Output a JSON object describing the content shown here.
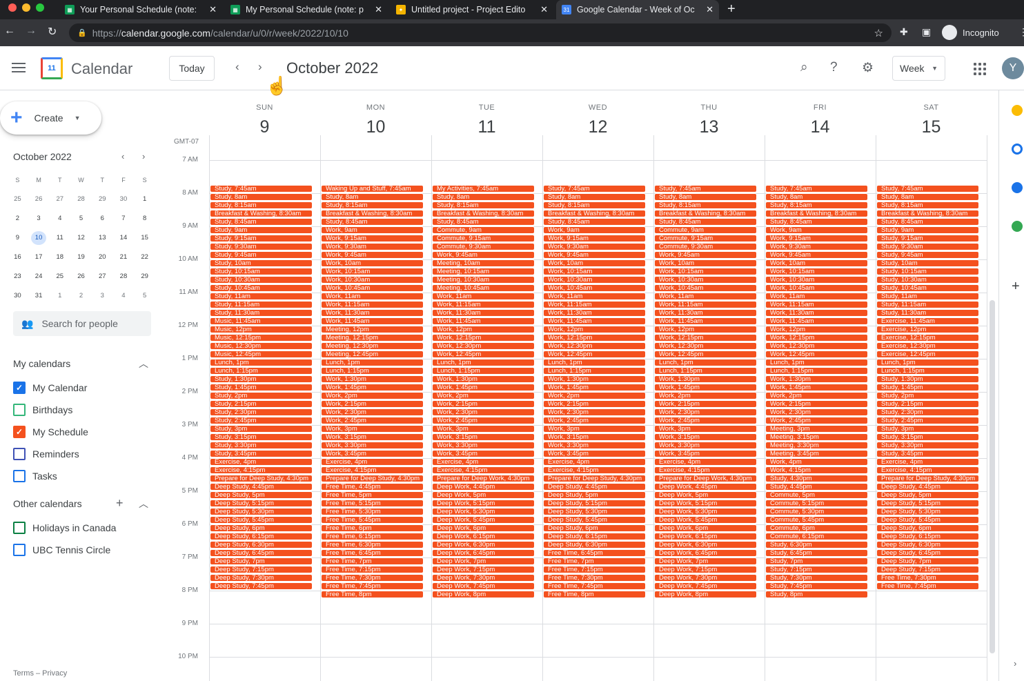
{
  "browser": {
    "tabs": [
      {
        "title": "Your Personal Schedule (note:",
        "icon": "sheets-icon",
        "color": "#0f9d58"
      },
      {
        "title": "My Personal Schedule (note: p",
        "icon": "sheets-icon",
        "color": "#0f9d58"
      },
      {
        "title": "Untitled project - Project Edito",
        "icon": "project-icon",
        "color": "#f4b400"
      },
      {
        "title": "Google Calendar - Week of Oc",
        "icon": "calendar-icon",
        "color": "#4285f4"
      }
    ],
    "url_prefix": "https://",
    "url_host": "calendar.google.com",
    "url_path": "/calendar/u/0/r/week/2022/10/10",
    "incognito_label": "Incognito"
  },
  "header": {
    "app_name": "Calendar",
    "logo_text": "11",
    "today_label": "Today",
    "title": "October 2022",
    "view_label": "Week",
    "avatar_letter": "Y"
  },
  "sidebar": {
    "create_label": "Create",
    "mini_title": "October 2022",
    "weekday_headers": [
      "S",
      "M",
      "T",
      "W",
      "T",
      "F",
      "S"
    ],
    "weeks": [
      [
        "25",
        "26",
        "27",
        "28",
        "29",
        "30",
        "1"
      ],
      [
        "2",
        "3",
        "4",
        "5",
        "6",
        "7",
        "8"
      ],
      [
        "9",
        "10",
        "11",
        "12",
        "13",
        "14",
        "15"
      ],
      [
        "16",
        "17",
        "18",
        "19",
        "20",
        "21",
        "22"
      ],
      [
        "23",
        "24",
        "25",
        "26",
        "27",
        "28",
        "29"
      ],
      [
        "30",
        "31",
        "1",
        "2",
        "3",
        "4",
        "5"
      ]
    ],
    "search_people_placeholder": "Search for people",
    "my_calendars_title": "My calendars",
    "my_calendars": [
      {
        "label": "My Calendar",
        "color": "#1a73e8",
        "checked": true
      },
      {
        "label": "Birthdays",
        "color": "#33b679",
        "checked": false
      },
      {
        "label": "My Schedule",
        "color": "#f4511e",
        "checked": true
      },
      {
        "label": "Reminders",
        "color": "#3f51b5",
        "checked": false
      },
      {
        "label": "Tasks",
        "color": "#1a73e8",
        "checked": false
      }
    ],
    "other_calendars_title": "Other calendars",
    "other_calendars": [
      {
        "label": "Holidays in Canada",
        "color": "#0b8043",
        "checked": false
      },
      {
        "label": "UBC Tennis Circle",
        "color": "#1a73e8",
        "checked": false
      }
    ],
    "footer": "Terms – Privacy"
  },
  "grid": {
    "timezone": "GMT-07",
    "days": [
      {
        "name": "SUN",
        "num": "9"
      },
      {
        "name": "MON",
        "num": "10"
      },
      {
        "name": "TUE",
        "num": "11"
      },
      {
        "name": "WED",
        "num": "12"
      },
      {
        "name": "THU",
        "num": "13"
      },
      {
        "name": "FRI",
        "num": "14"
      },
      {
        "name": "SAT",
        "num": "15"
      }
    ],
    "hours": [
      "7 AM",
      "8 AM",
      "9 AM",
      "10 AM",
      "11 AM",
      "12 PM",
      "1 PM",
      "2 PM",
      "3 PM",
      "4 PM",
      "5 PM",
      "6 PM",
      "7 PM",
      "8 PM",
      "9 PM",
      "10 PM"
    ],
    "event_color": "#f4511e",
    "events": [
      [
        "Study, 7:45am",
        "Study, 8am",
        "Study, 8:15am",
        "Breakfast & Washing, 8:30am",
        "Study, 8:45am",
        "Study, 9am",
        "Study, 9:15am",
        "Study, 9:30am",
        "Study, 9:45am",
        "Study, 10am",
        "Study, 10:15am",
        "Study, 10:30am",
        "Study, 10:45am",
        "Study, 11am",
        "Study, 11:15am",
        "Study, 11:30am",
        "Music, 11:45am",
        "Music, 12pm",
        "Music, 12:15pm",
        "Music, 12:30pm",
        "Music, 12:45pm",
        "Lunch, 1pm",
        "Lunch, 1:15pm",
        "Study, 1:30pm",
        "Study, 1:45pm",
        "Study, 2pm",
        "Study, 2:15pm",
        "Study, 2:30pm",
        "Study, 2:45pm",
        "Study, 3pm",
        "Study, 3:15pm",
        "Study, 3:30pm",
        "Study, 3:45pm",
        "Exercise, 4pm",
        "Exercise, 4:15pm",
        "Prepare for Deep Study, 4:30pm",
        "Deep Study, 4:45pm",
        "Deep Study, 5pm",
        "Deep Study, 5:15pm",
        "Deep Study, 5:30pm",
        "Deep Study, 5:45pm",
        "Deep Study, 6pm",
        "Deep Study, 6:15pm",
        "Deep Study, 6:30pm",
        "Deep Study, 6:45pm",
        "Deep Study, 7pm",
        "Deep Study, 7:15pm",
        "Deep Study, 7:30pm",
        "Deep Study, 7:45pm"
      ],
      [
        "Waking Up and Stuff, 7:45am",
        "Study, 8am",
        "Study, 8:15am",
        "Breakfast & Washing, 8:30am",
        "Study, 8:45am",
        "Work, 9am",
        "Work, 9:15am",
        "Work, 9:30am",
        "Work, 9:45am",
        "Work, 10am",
        "Work, 10:15am",
        "Work, 10:30am",
        "Work, 10:45am",
        "Work, 11am",
        "Work, 11:15am",
        "Work, 11:30am",
        "Work, 11:45am",
        "Meeting, 12pm",
        "Meeting, 12:15pm",
        "Meeting, 12:30pm",
        "Meeting, 12:45pm",
        "Lunch, 1pm",
        "Lunch, 1:15pm",
        "Work, 1:30pm",
        "Work, 1:45pm",
        "Work, 2pm",
        "Work, 2:15pm",
        "Work, 2:30pm",
        "Work, 2:45pm",
        "Work, 3pm",
        "Work, 3:15pm",
        "Work, 3:30pm",
        "Work, 3:45pm",
        "Exercise, 4pm",
        "Exercise, 4:15pm",
        "Prepare for Deep Study, 4:30pm",
        "Free Time, 4:45pm",
        "Free Time, 5pm",
        "Free Time, 5:15pm",
        "Free Time, 5:30pm",
        "Free Time, 5:45pm",
        "Free Time, 6pm",
        "Free Time, 6:15pm",
        "Free Time, 6:30pm",
        "Free Time, 6:45pm",
        "Free Time, 7pm",
        "Free Time, 7:15pm",
        "Free Time, 7:30pm",
        "Free Time, 7:45pm",
        "Free Time, 8pm"
      ],
      [
        "My Activities, 7:45am",
        "Study, 8am",
        "Study, 8:15am",
        "Breakfast & Washing, 8:30am",
        "Study, 8:45am",
        "Commute, 9am",
        "Commute, 9:15am",
        "Commute, 9:30am",
        "Work, 9:45am",
        "Meeting, 10am",
        "Meeting, 10:15am",
        "Meeting, 10:30am",
        "Meeting, 10:45am",
        "Work, 11am",
        "Work, 11:15am",
        "Work, 11:30am",
        "Work, 11:45am",
        "Work, 12pm",
        "Work, 12:15pm",
        "Work, 12:30pm",
        "Work, 12:45pm",
        "Lunch, 1pm",
        "Lunch, 1:15pm",
        "Work, 1:30pm",
        "Work, 1:45pm",
        "Work, 2pm",
        "Work, 2:15pm",
        "Work, 2:30pm",
        "Work, 2:45pm",
        "Work, 3pm",
        "Work, 3:15pm",
        "Work, 3:30pm",
        "Work, 3:45pm",
        "Exercise, 4pm",
        "Exercise, 4:15pm",
        "Prepare for Deep Work, 4:30pm",
        "Deep Work, 4:45pm",
        "Deep Work, 5pm",
        "Deep Work, 5:15pm",
        "Deep Work, 5:30pm",
        "Deep Work, 5:45pm",
        "Deep Work, 6pm",
        "Deep Work, 6:15pm",
        "Deep Work, 6:30pm",
        "Deep Work, 6:45pm",
        "Deep Work, 7pm",
        "Deep Work, 7:15pm",
        "Deep Work, 7:30pm",
        "Deep Work, 7:45pm",
        "Deep Work, 8pm"
      ],
      [
        "Study, 7:45am",
        "Study, 8am",
        "Study, 8:15am",
        "Breakfast & Washing, 8:30am",
        "Study, 8:45am",
        "Work, 9am",
        "Work, 9:15am",
        "Work, 9:30am",
        "Work, 9:45am",
        "Work, 10am",
        "Work, 10:15am",
        "Work, 10:30am",
        "Work, 10:45am",
        "Work, 11am",
        "Work, 11:15am",
        "Work, 11:30am",
        "Work, 11:45am",
        "Work, 12pm",
        "Work, 12:15pm",
        "Work, 12:30pm",
        "Work, 12:45pm",
        "Lunch, 1pm",
        "Lunch, 1:15pm",
        "Work, 1:30pm",
        "Work, 1:45pm",
        "Work, 2pm",
        "Work, 2:15pm",
        "Work, 2:30pm",
        "Work, 2:45pm",
        "Work, 3pm",
        "Work, 3:15pm",
        "Work, 3:30pm",
        "Work, 3:45pm",
        "Exercise, 4pm",
        "Exercise, 4:15pm",
        "Prepare for Deep Study, 4:30pm",
        "Deep Study, 4:45pm",
        "Deep Study, 5pm",
        "Deep Study, 5:15pm",
        "Deep Study, 5:30pm",
        "Deep Study, 5:45pm",
        "Deep Study, 6pm",
        "Deep Study, 6:15pm",
        "Deep Study, 6:30pm",
        "Free Time, 6:45pm",
        "Free Time, 7pm",
        "Free Time, 7:15pm",
        "Free Time, 7:30pm",
        "Free Time, 7:45pm",
        "Free Time, 8pm"
      ],
      [
        "Study, 7:45am",
        "Study, 8am",
        "Study, 8:15am",
        "Breakfast & Washing, 8:30am",
        "Study, 8:45am",
        "Commute, 9am",
        "Commute, 9:15am",
        "Commute, 9:30am",
        "Work, 9:45am",
        "Work, 10am",
        "Work, 10:15am",
        "Work, 10:30am",
        "Work, 10:45am",
        "Work, 11am",
        "Work, 11:15am",
        "Work, 11:30am",
        "Work, 11:45am",
        "Work, 12pm",
        "Work, 12:15pm",
        "Work, 12:30pm",
        "Work, 12:45pm",
        "Lunch, 1pm",
        "Lunch, 1:15pm",
        "Work, 1:30pm",
        "Work, 1:45pm",
        "Work, 2pm",
        "Work, 2:15pm",
        "Work, 2:30pm",
        "Work, 2:45pm",
        "Work, 3pm",
        "Work, 3:15pm",
        "Work, 3:30pm",
        "Work, 3:45pm",
        "Exercise, 4pm",
        "Exercise, 4:15pm",
        "Prepare for Deep Work, 4:30pm",
        "Deep Work, 4:45pm",
        "Deep Work, 5pm",
        "Deep Work, 5:15pm",
        "Deep Work, 5:30pm",
        "Deep Work, 5:45pm",
        "Deep Work, 6pm",
        "Deep Work, 6:15pm",
        "Deep Work, 6:30pm",
        "Deep Work, 6:45pm",
        "Deep Work, 7pm",
        "Deep Work, 7:15pm",
        "Deep Work, 7:30pm",
        "Deep Work, 7:45pm",
        "Deep Work, 8pm"
      ],
      [
        "Study, 7:45am",
        "Study, 8am",
        "Study, 8:15am",
        "Breakfast & Washing, 8:30am",
        "Study, 8:45am",
        "Work, 9am",
        "Work, 9:15am",
        "Work, 9:30am",
        "Work, 9:45am",
        "Work, 10am",
        "Work, 10:15am",
        "Work, 10:30am",
        "Work, 10:45am",
        "Work, 11am",
        "Work, 11:15am",
        "Work, 11:30am",
        "Work, 11:45am",
        "Work, 12pm",
        "Work, 12:15pm",
        "Work, 12:30pm",
        "Work, 12:45pm",
        "Lunch, 1pm",
        "Lunch, 1:15pm",
        "Work, 1:30pm",
        "Work, 1:45pm",
        "Work, 2pm",
        "Work, 2:15pm",
        "Work, 2:30pm",
        "Work, 2:45pm",
        "Meeting, 3pm",
        "Meeting, 3:15pm",
        "Meeting, 3:30pm",
        "Meeting, 3:45pm",
        "Work, 4pm",
        "Work, 4:15pm",
        "Study, 4:30pm",
        "Study, 4:45pm",
        "Commute, 5pm",
        "Commute, 5:15pm",
        "Commute, 5:30pm",
        "Commute, 5:45pm",
        "Commute, 6pm",
        "Commute, 6:15pm",
        "Study, 6:30pm",
        "Study, 6:45pm",
        "Study, 7pm",
        "Study, 7:15pm",
        "Study, 7:30pm",
        "Study, 7:45pm",
        "Study, 8pm"
      ],
      [
        "Study, 7:45am",
        "Study, 8am",
        "Study, 8:15am",
        "Breakfast & Washing, 8:30am",
        "Study, 8:45am",
        "Study, 9am",
        "Study, 9:15am",
        "Study, 9:30am",
        "Study, 9:45am",
        "Study, 10am",
        "Study, 10:15am",
        "Study, 10:30am",
        "Study, 10:45am",
        "Study, 11am",
        "Study, 11:15am",
        "Study, 11:30am",
        "Exercise, 11:45am",
        "Exercise, 12pm",
        "Exercise, 12:15pm",
        "Exercise, 12:30pm",
        "Exercise, 12:45pm",
        "Lunch, 1pm",
        "Lunch, 1:15pm",
        "Study, 1:30pm",
        "Study, 1:45pm",
        "Study, 2pm",
        "Study, 2:15pm",
        "Study, 2:30pm",
        "Study, 2:45pm",
        "Study, 3pm",
        "Study, 3:15pm",
        "Study, 3:30pm",
        "Study, 3:45pm",
        "Exercise, 4pm",
        "Exercise, 4:15pm",
        "Prepare for Deep Study, 4:30pm",
        "Deep Study, 4:45pm",
        "Deep Study, 5pm",
        "Deep Study, 5:15pm",
        "Deep Study, 5:30pm",
        "Deep Study, 5:45pm",
        "Deep Study, 6pm",
        "Deep Study, 6:15pm",
        "Deep Study, 6:30pm",
        "Deep Study, 6:45pm",
        "Deep Study, 7pm",
        "Deep Study, 7:15pm",
        "Free Time, 7:30pm",
        "Free Time, 7:45pm"
      ]
    ]
  }
}
